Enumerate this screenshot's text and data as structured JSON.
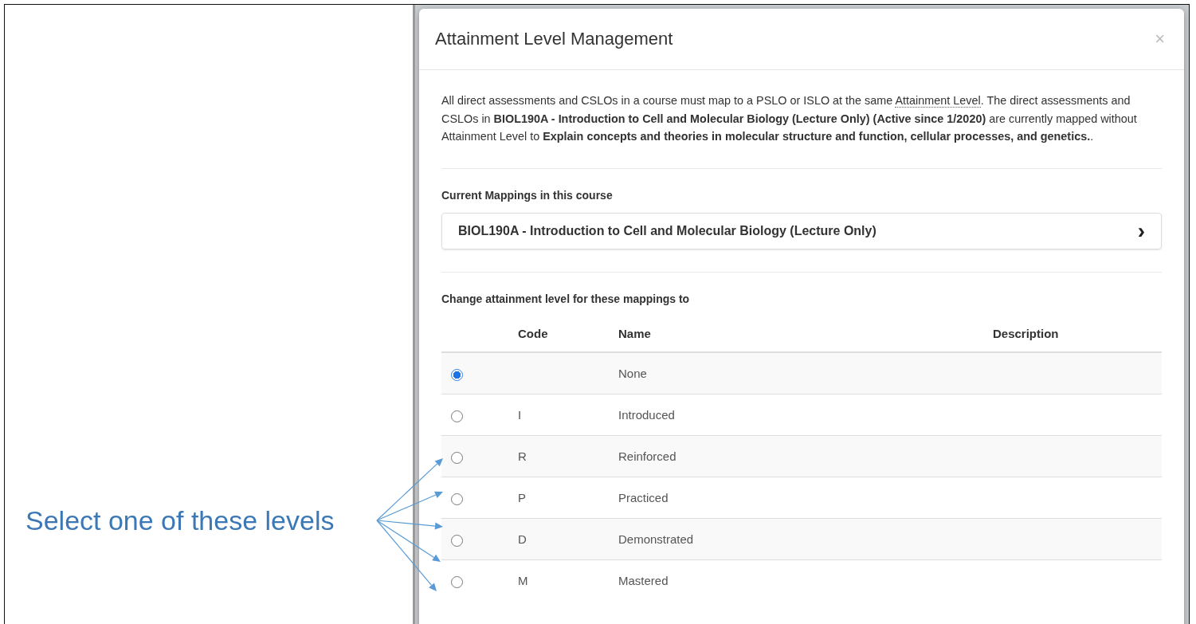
{
  "annotation": {
    "text": "Select one of these levels"
  },
  "modal": {
    "title": "Attainment Level Management",
    "close": "×",
    "intro": [
      {
        "kind": "text",
        "text": "All direct assessments and CSLOs in a course must map to a PSLO or ISLO at the same "
      },
      {
        "kind": "term",
        "text": "Attainment Level"
      },
      {
        "kind": "text",
        "text": ". The direct assessments and CSLOs in "
      },
      {
        "kind": "bold",
        "text": "BIOL190A - Introduction to Cell and Molecular Biology (Lecture Only) (Active since 1/2020)"
      },
      {
        "kind": "text",
        "text": " are currently mapped without Attainment Level to "
      },
      {
        "kind": "bold",
        "text": "Explain concepts and theories in molecular structure and function, cellular processes, and genetics."
      },
      {
        "kind": "text",
        "text": "."
      }
    ],
    "mappings_label": "Current Mappings in this course",
    "mappings": [
      {
        "label": "BIOL190A - Introduction to Cell and Molecular Biology (Lecture Only)",
        "chevron": "›"
      }
    ],
    "change_label": "Change attainment level for these mappings to",
    "table": {
      "columns": [
        "Code",
        "Name",
        "Description"
      ],
      "rows": [
        {
          "code": "",
          "name": "None",
          "selected": true
        },
        {
          "code": "I",
          "name": "Introduced",
          "selected": false
        },
        {
          "code": "R",
          "name": "Reinforced",
          "selected": false
        },
        {
          "code": "P",
          "name": "Practiced",
          "selected": false
        },
        {
          "code": "D",
          "name": "Demonstrated",
          "selected": false
        },
        {
          "code": "M",
          "name": "Mastered",
          "selected": false
        }
      ]
    }
  }
}
